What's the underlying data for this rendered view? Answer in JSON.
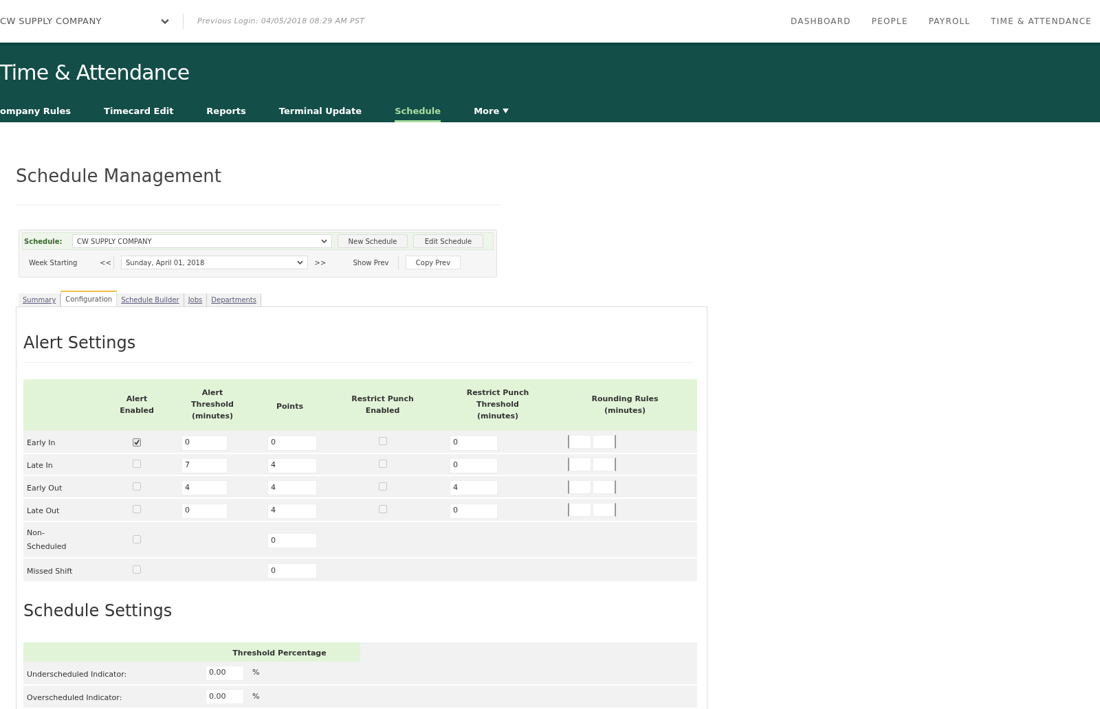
{
  "top_bar": {
    "company_selector": {
      "value": "CW SUPPLY COMPANY"
    },
    "previous_login": "Previous Login: 04/05/2018 08:29 AM PST",
    "nav": [
      "DASHBOARD",
      "PEOPLE",
      "PAYROLL",
      "TIME & ATTENDANCE"
    ]
  },
  "header": {
    "title": "Time & Attendance",
    "tabs": [
      {
        "label": "ompany Rules",
        "kind": "link",
        "selected": false
      },
      {
        "label": "Timecard Edit",
        "kind": "link",
        "selected": false
      },
      {
        "label": "Reports",
        "kind": "link",
        "selected": false
      },
      {
        "label": "Terminal Update",
        "kind": "link",
        "selected": false
      },
      {
        "label": "Schedule",
        "kind": "link",
        "selected": true
      },
      {
        "label": "More",
        "kind": "menu",
        "selected": false
      }
    ]
  },
  "page_title": "Schedule Management",
  "schedule_toolbar": {
    "schedule_label": "Schedule:",
    "schedule_select": {
      "value": "CW SUPPLY COMPANY"
    },
    "buttons": [
      "New Schedule",
      "Edit Schedule"
    ],
    "week_label": "Week Starting",
    "prev_button": "<<",
    "week_select": {
      "value": "Sunday, April 01, 2018"
    },
    "next_button": ">>",
    "week_buttons": [
      "Show Prev",
      "Copy Prev"
    ]
  },
  "sub_tabs": [
    {
      "label": "Summary",
      "selected": false
    },
    {
      "label": "Configuration",
      "selected": true
    },
    {
      "label": "Schedule Builder",
      "selected": false
    },
    {
      "label": "Jobs",
      "selected": false
    },
    {
      "label": "Departments",
      "selected": false
    }
  ],
  "alert_settings": {
    "heading": "Alert Settings",
    "columns": [
      "Alert Enabled",
      "Alert Threshold (minutes)",
      "Points",
      "Restrict Punch Enabled",
      "Restrict Punch Threshold (minutes)",
      "Rounding Rules (minutes)"
    ],
    "rows": [
      {
        "kind": "full",
        "label": "Early In",
        "alert_enabled": true,
        "alert_threshold": "0",
        "points": "0",
        "restrict_punch_enabled": false,
        "restrict_punch_threshold": "0"
      },
      {
        "kind": "full",
        "label": "Late In",
        "alert_enabled": false,
        "alert_threshold": "7",
        "points": "4",
        "restrict_punch_enabled": false,
        "restrict_punch_threshold": "0"
      },
      {
        "kind": "full",
        "label": "Early Out",
        "alert_enabled": false,
        "alert_threshold": "4",
        "points": "4",
        "restrict_punch_enabled": false,
        "restrict_punch_threshold": "4"
      },
      {
        "kind": "full",
        "label": "Late Out",
        "alert_enabled": false,
        "alert_threshold": "0",
        "points": "4",
        "restrict_punch_enabled": false,
        "restrict_punch_threshold": "0"
      },
      {
        "kind": "points_only",
        "label": "Non-Scheduled",
        "alert_enabled": false,
        "points": "0"
      },
      {
        "kind": "points_only",
        "label": "Missed Shift",
        "alert_enabled": false,
        "points": "0"
      }
    ]
  },
  "schedule_settings": {
    "heading": "Schedule Settings",
    "column": "Threshold Percentage",
    "rows": [
      {
        "label": "Underscheduled Indicator:",
        "value": "0.00",
        "unit": "%"
      },
      {
        "label": "Overscheduled Indicator:",
        "value": "0.00",
        "unit": "%"
      }
    ]
  }
}
